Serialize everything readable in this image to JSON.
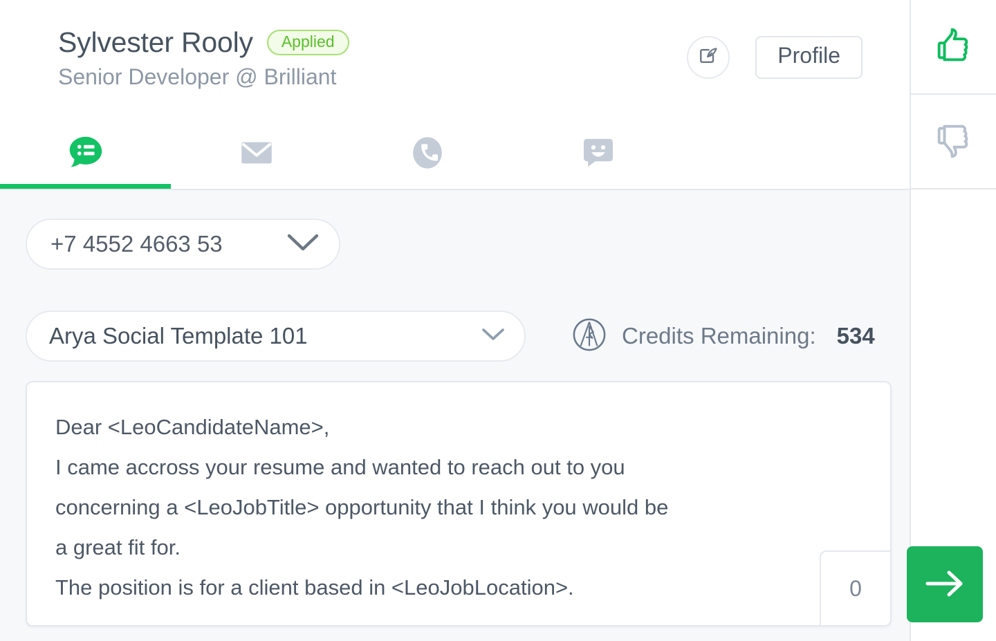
{
  "candidate": {
    "name": "Sylvester Rooly",
    "status": "Applied",
    "subtitle": "Senior Developer @ Brilliant"
  },
  "header": {
    "compose_icon": "compose-note-icon",
    "profile_label": "Profile"
  },
  "tabs": [
    {
      "icon": "activity-bubble-icon",
      "name": "activity",
      "active": true
    },
    {
      "icon": "envelope-icon",
      "name": "email",
      "active": false
    },
    {
      "icon": "phone-circle-icon",
      "name": "call",
      "active": false
    },
    {
      "icon": "chat-smiley-icon",
      "name": "chat",
      "active": false
    }
  ],
  "phone": {
    "value": "+7 4552 4663 53",
    "chevron_icon": "chevron-down-icon"
  },
  "template": {
    "value": "Arya Social Template 101",
    "chevron_icon": "chevron-down-icon"
  },
  "credits": {
    "logo_icon": "arya-logo-icon",
    "label": "Credits Remaining:",
    "count": "534"
  },
  "message": {
    "body": "Dear <LeoCandidateName>,\nI came accross your resume and wanted to reach out to you\nconcerning a <LeoJobTitle> opportunity that I think you would be\na great fit for.\nThe position is for a client based in <LeoJobLocation>.",
    "char_count": "0"
  },
  "send": {
    "icon": "arrow-right-icon"
  },
  "rail": {
    "thumbs_up_icon": "thumbs-up-icon",
    "thumbs_down_icon": "thumbs-down-icon"
  },
  "colors": {
    "accent_green": "#13c264",
    "send_green": "#1cb35c",
    "badge_green": "#58c128",
    "muted_gray": "#c2cbd8",
    "text_dark": "#46525f",
    "bg": "#f7f8fa"
  }
}
